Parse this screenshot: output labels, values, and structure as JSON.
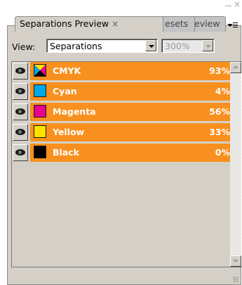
{
  "panel": {
    "tabs": [
      {
        "label": "Separations Preview",
        "active": true
      },
      {
        "label": "esets",
        "active": false
      },
      {
        "label": "eview",
        "active": false
      }
    ],
    "close_glyph": "×"
  },
  "view": {
    "label": "View:",
    "selected": "Separations",
    "zoom": "300%"
  },
  "separations": [
    {
      "name": "CMYK",
      "percent": "93%",
      "swatch": "cmyk-icon"
    },
    {
      "name": "Cyan",
      "percent": "4%",
      "swatch": "#00a8e8"
    },
    {
      "name": "Magenta",
      "percent": "56%",
      "swatch": "#e8008c"
    },
    {
      "name": "Yellow",
      "percent": "33%",
      "swatch": "#ffe100"
    },
    {
      "name": "Black",
      "percent": "0%",
      "swatch": "#000000"
    }
  ],
  "colors": {
    "row_highlight": "#f7901e",
    "panel_bg": "#d4d0c8"
  }
}
